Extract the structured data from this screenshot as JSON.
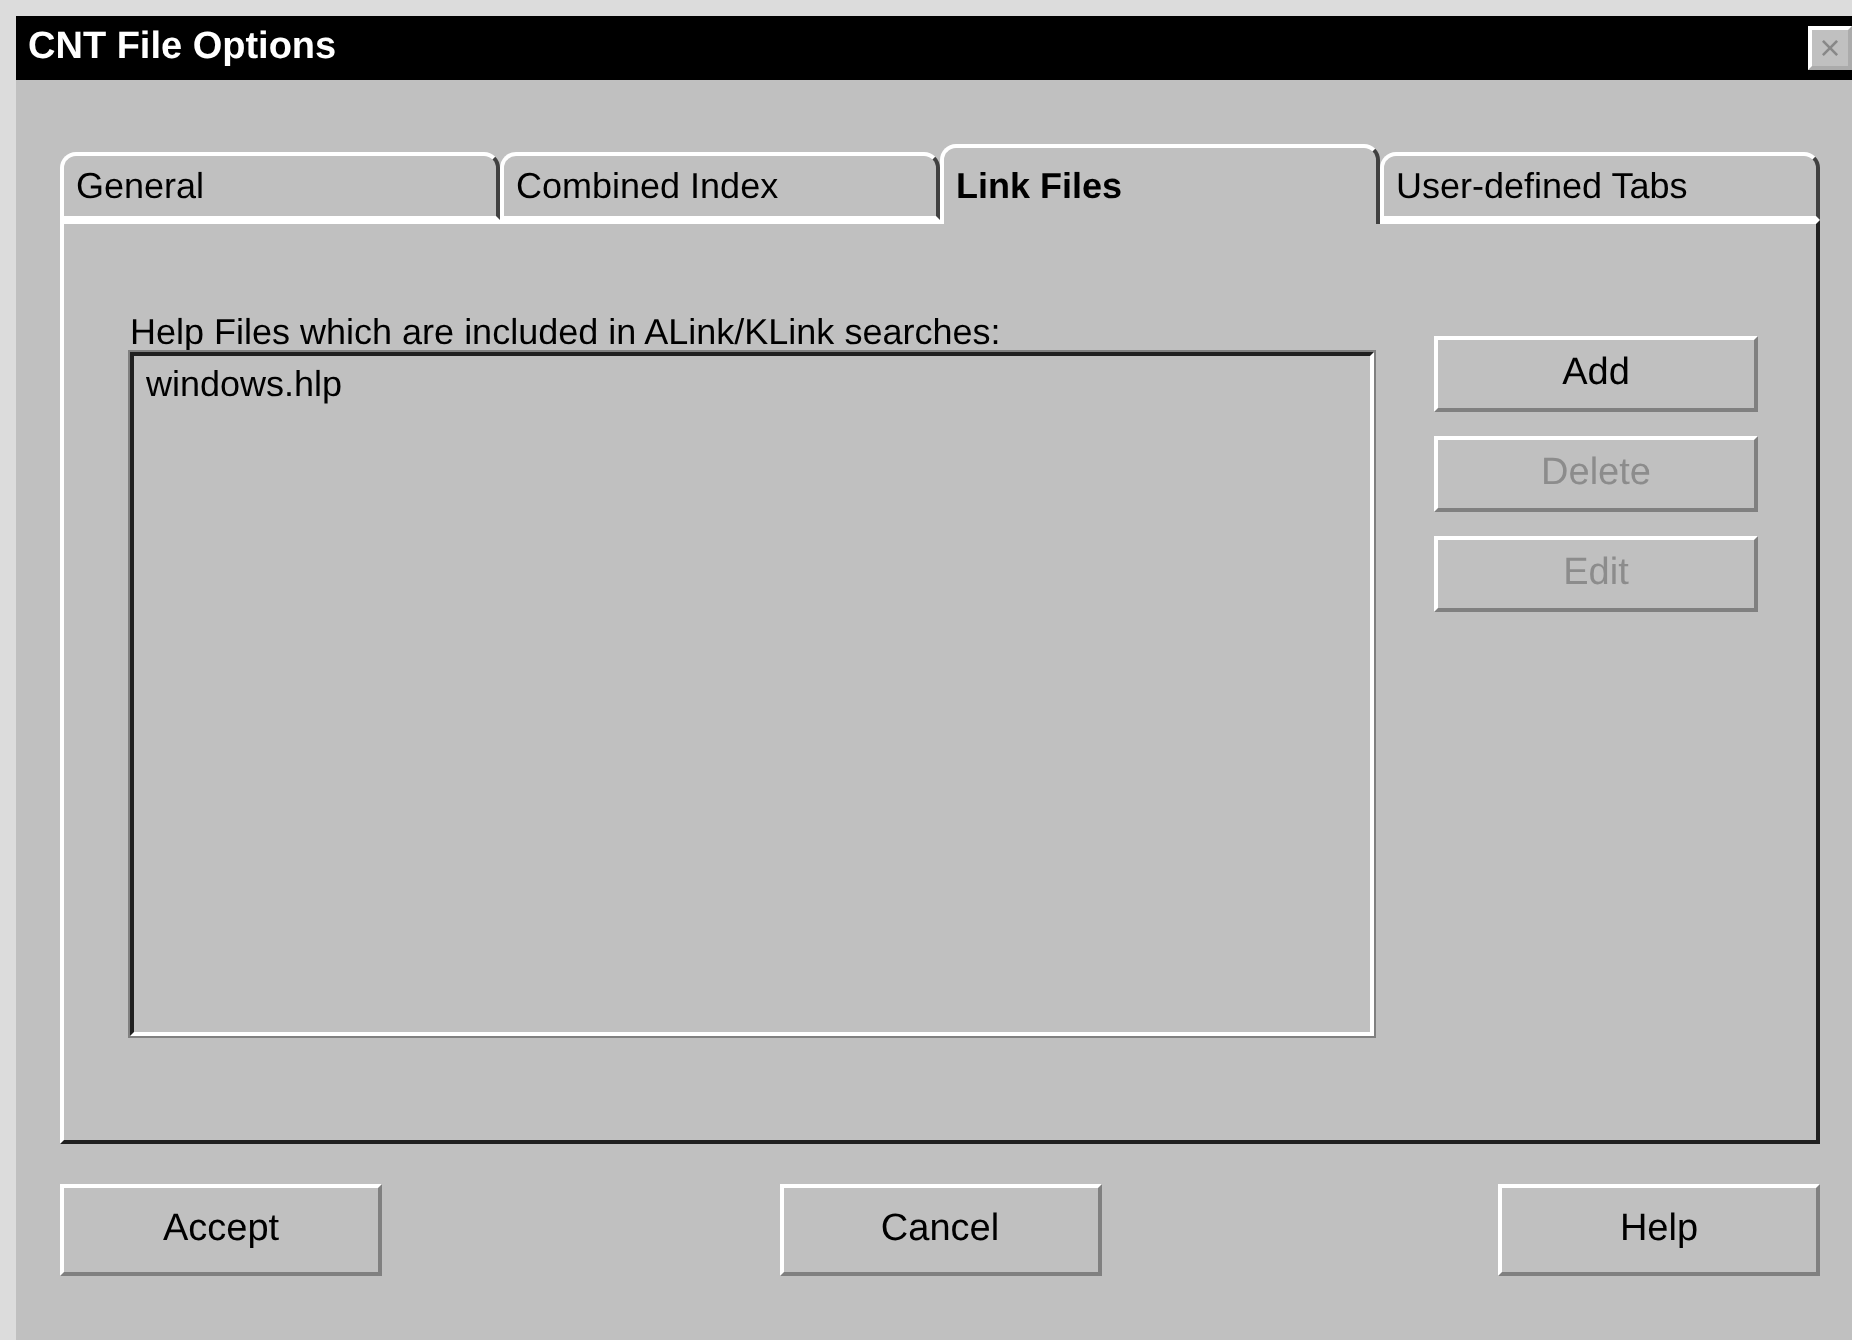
{
  "window": {
    "title": "CNT File Options",
    "close_glyph": "×"
  },
  "tabs": [
    {
      "label": "General",
      "selected": false
    },
    {
      "label": "Combined Index",
      "selected": false
    },
    {
      "label": "Link Files",
      "selected": true
    },
    {
      "label": "User-defined Tabs",
      "selected": false
    }
  ],
  "list_label": "Help Files which are included in ALink/KLink searches:",
  "list_items": [
    {
      "label": "windows.hlp",
      "selected": false
    }
  ],
  "side_buttons": [
    {
      "label": "Add",
      "disabled": false
    },
    {
      "label": "Delete",
      "disabled": true
    },
    {
      "label": "Edit",
      "disabled": true
    }
  ],
  "bottom_buttons": [
    {
      "label": "Accept",
      "disabled": false
    },
    {
      "label": "Cancel",
      "disabled": false
    },
    {
      "label": "Help",
      "disabled": false
    }
  ]
}
